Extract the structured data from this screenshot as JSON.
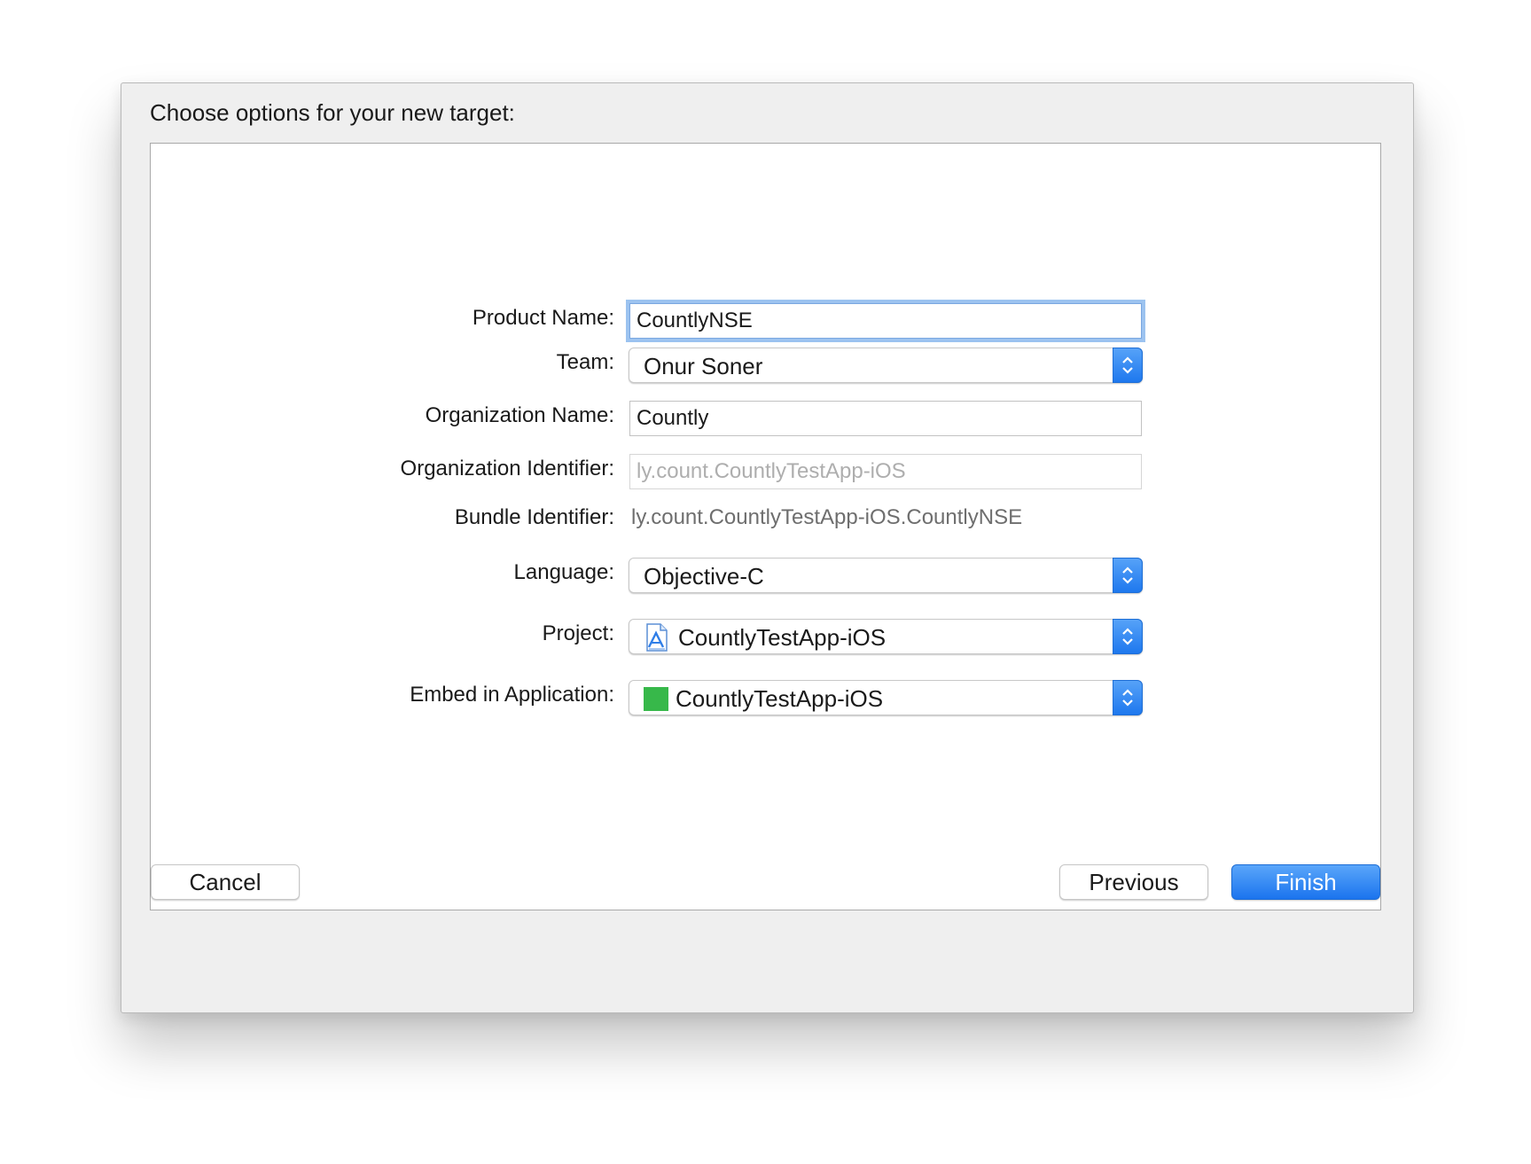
{
  "dialog": {
    "title": "Choose options for your new target:"
  },
  "form": {
    "product_name": {
      "label": "Product Name:",
      "value": "CountlyNSE"
    },
    "team": {
      "label": "Team:",
      "value": "Onur Soner"
    },
    "organization_name": {
      "label": "Organization Name:",
      "value": "Countly"
    },
    "organization_identifier": {
      "label": "Organization Identifier:",
      "placeholder": "ly.count.CountlyTestApp-iOS"
    },
    "bundle_identifier": {
      "label": "Bundle Identifier:",
      "value": "ly.count.CountlyTestApp-iOS.CountlyNSE"
    },
    "language": {
      "label": "Language:",
      "value": "Objective-C"
    },
    "project": {
      "label": "Project:",
      "value": "CountlyTestApp-iOS",
      "icon": "xcode-project-icon"
    },
    "embed_in_application": {
      "label": "Embed in Application:",
      "value": "CountlyTestApp-iOS",
      "icon": "app-target-icon"
    }
  },
  "buttons": {
    "cancel": "Cancel",
    "previous": "Previous",
    "finish": "Finish"
  },
  "colors": {
    "accent": "#1e78ee",
    "focus_ring": "#9cc3f0",
    "app_icon": "#37b84a"
  }
}
